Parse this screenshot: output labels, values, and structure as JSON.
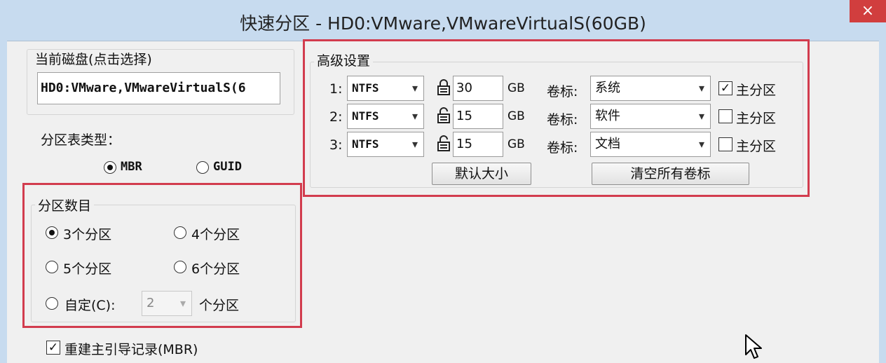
{
  "window": {
    "title": "快速分区 - HD0:VMware,VMwareVirtualS(60GB)",
    "close_glyph": "×"
  },
  "disk": {
    "group_label": "当前磁盘(点击选择)",
    "value": "HD0:VMware,VMwareVirtualS(6"
  },
  "partition_table": {
    "label": "分区表类型：",
    "options": [
      {
        "label": "MBR",
        "checked": true
      },
      {
        "label": "GUID",
        "checked": false
      }
    ]
  },
  "partition_count": {
    "group_label": "分区数目",
    "options": [
      {
        "label": "3个分区",
        "checked": true
      },
      {
        "label": "4个分区",
        "checked": false
      },
      {
        "label": "5个分区",
        "checked": false
      },
      {
        "label": "6个分区",
        "checked": false
      },
      {
        "label": "自定(C):",
        "checked": false
      }
    ],
    "custom_value": "2",
    "custom_suffix": "个分区"
  },
  "rebuild_mbr": {
    "label": "重建主引导记录(MBR)",
    "checked": true
  },
  "advanced": {
    "group_label": "高级设置",
    "unit": "GB",
    "volume_label_caption": "卷标:",
    "primary_caption": "主分区",
    "rows": [
      {
        "index": "1:",
        "fs": "NTFS",
        "locked": true,
        "size": "30",
        "volume": "系统",
        "primary": true
      },
      {
        "index": "2:",
        "fs": "NTFS",
        "locked": false,
        "size": "15",
        "volume": "软件",
        "primary": false
      },
      {
        "index": "3:",
        "fs": "NTFS",
        "locked": false,
        "size": "15",
        "volume": "文档",
        "primary": false
      }
    ],
    "default_size_button": "默认大小",
    "clear_labels_button": "清空所有卷标"
  },
  "icons": {
    "caret": "▾",
    "check": "✓",
    "locked_icon": "lock-icon",
    "unlocked_icon": "unlock-icon"
  },
  "colors": {
    "highlight": "#d23c4e",
    "titlebar": "#c7dbef",
    "close": "#d13e3e"
  }
}
